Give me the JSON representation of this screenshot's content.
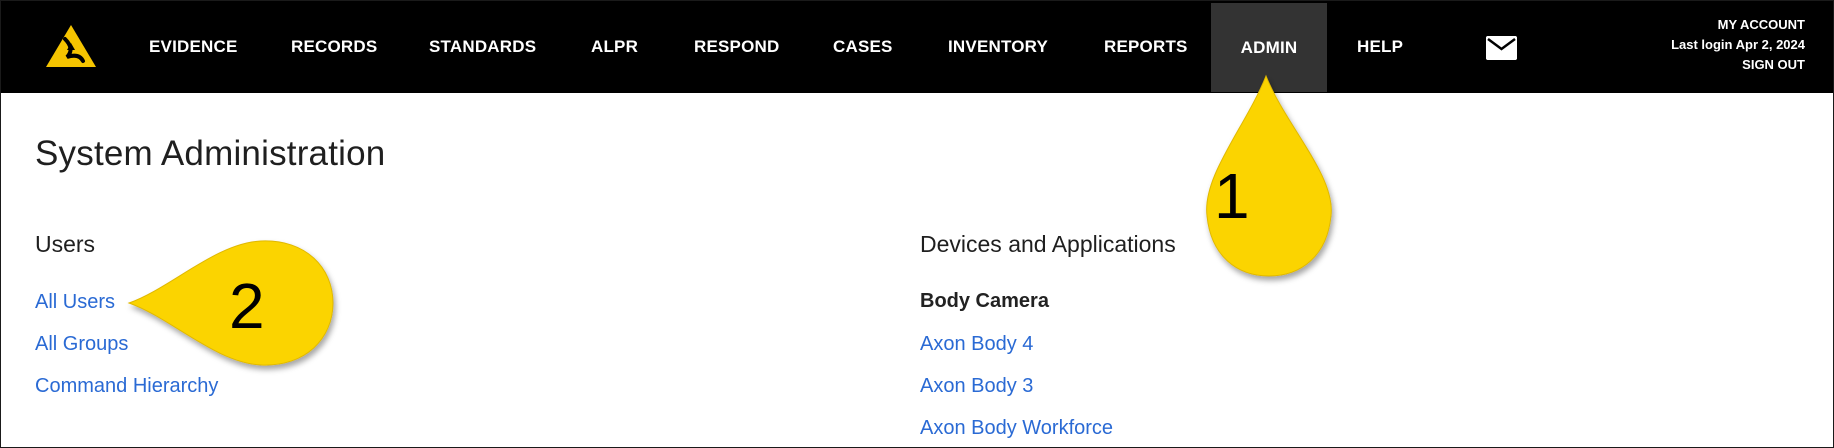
{
  "nav": {
    "items": [
      {
        "label": "EVIDENCE"
      },
      {
        "label": "RECORDS"
      },
      {
        "label": "STANDARDS"
      },
      {
        "label": "ALPR"
      },
      {
        "label": "RESPOND"
      },
      {
        "label": "CASES"
      },
      {
        "label": "INVENTORY"
      },
      {
        "label": "REPORTS"
      },
      {
        "label": "ADMIN",
        "active": true
      },
      {
        "label": "HELP"
      }
    ],
    "mail_icon": "envelope-icon",
    "logo_icon": "axon-logo-icon"
  },
  "account": {
    "my_account": "MY ACCOUNT",
    "last_login": "Last login Apr 2, 2024",
    "sign_out": "SIGN OUT"
  },
  "page": {
    "title": "System Administration"
  },
  "users": {
    "heading": "Users",
    "links": [
      "All Users",
      "All Groups",
      "Command Hierarchy"
    ]
  },
  "devices": {
    "heading": "Devices and Applications",
    "subheading": "Body Camera",
    "links": [
      "Axon Body 4",
      "Axon Body 3",
      "Axon Body Workforce"
    ]
  },
  "callouts": [
    "1",
    "2"
  ],
  "colors": {
    "nav_bg": "#000000",
    "nav_active_bg": "#333333",
    "link": "#2a6ad4",
    "callout_fill": "#fbd400",
    "logo_yellow": "#f5c400"
  }
}
